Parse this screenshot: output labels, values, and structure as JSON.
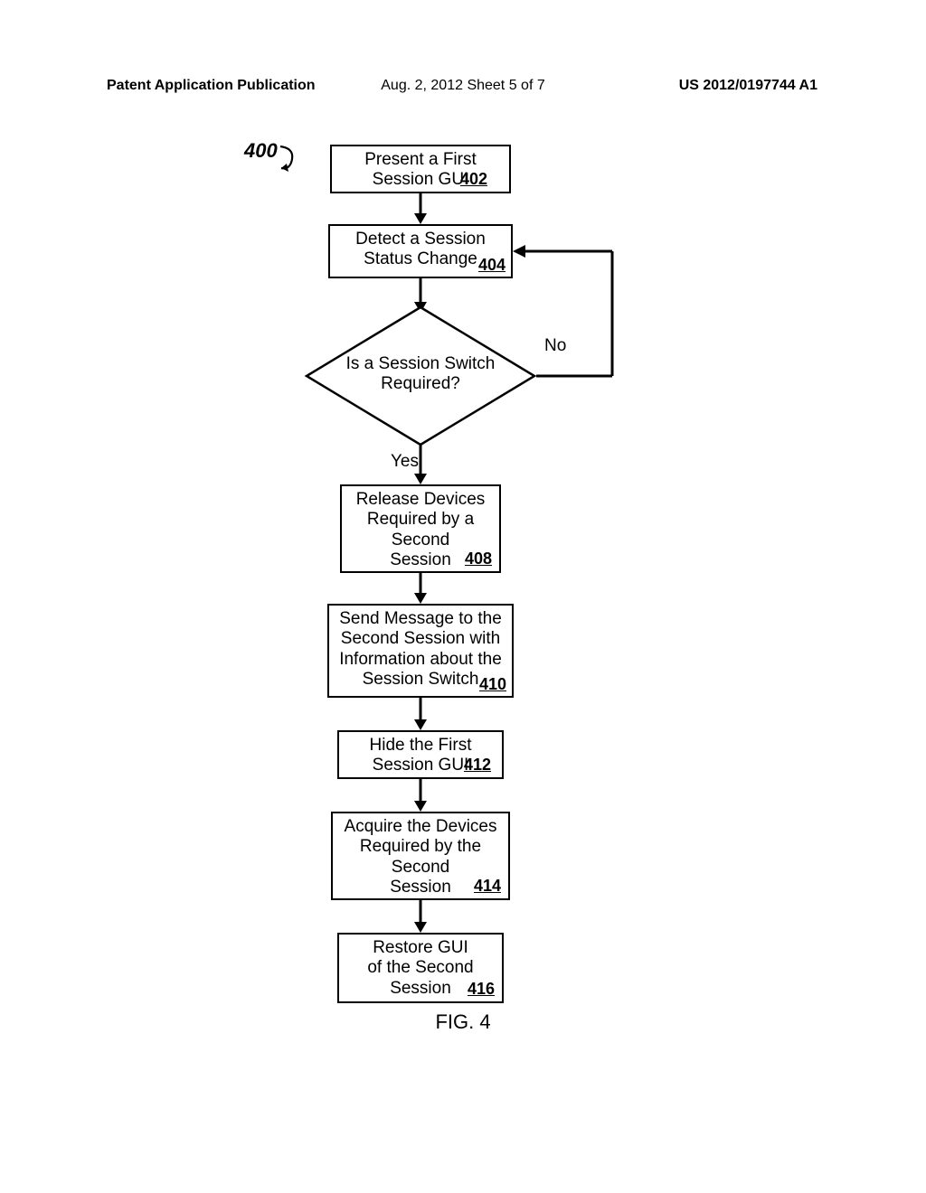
{
  "header": {
    "left": "Patent Application Publication",
    "center": "Aug. 2, 2012  Sheet 5 of 7",
    "right": "US 2012/0197744 A1"
  },
  "ref400": "400",
  "boxes": {
    "b402": {
      "text": "Present a First\nSession GUI",
      "ref": "402"
    },
    "b404": {
      "text": "Detect a Session\nStatus Change",
      "ref": "404"
    },
    "dec": {
      "text": "Is a Session\nSwitch Required?"
    },
    "b408": {
      "text": "Release Devices\nRequired by a\nSecond\nSession",
      "ref": "408"
    },
    "b410": {
      "text": "Send Message to the\nSecond Session with\nInformation about the\nSession Switch",
      "ref": "410"
    },
    "b412": {
      "text": "Hide the First\nSession GUI",
      "ref": "412"
    },
    "b414": {
      "text": "Acquire the Devices\nRequired by the\nSecond\nSession",
      "ref": "414"
    },
    "b416": {
      "text": "Restore GUI\nof the Second\nSession",
      "ref": "416"
    }
  },
  "labels": {
    "yes": "Yes",
    "no": "No"
  },
  "figure": "FIG. 4"
}
